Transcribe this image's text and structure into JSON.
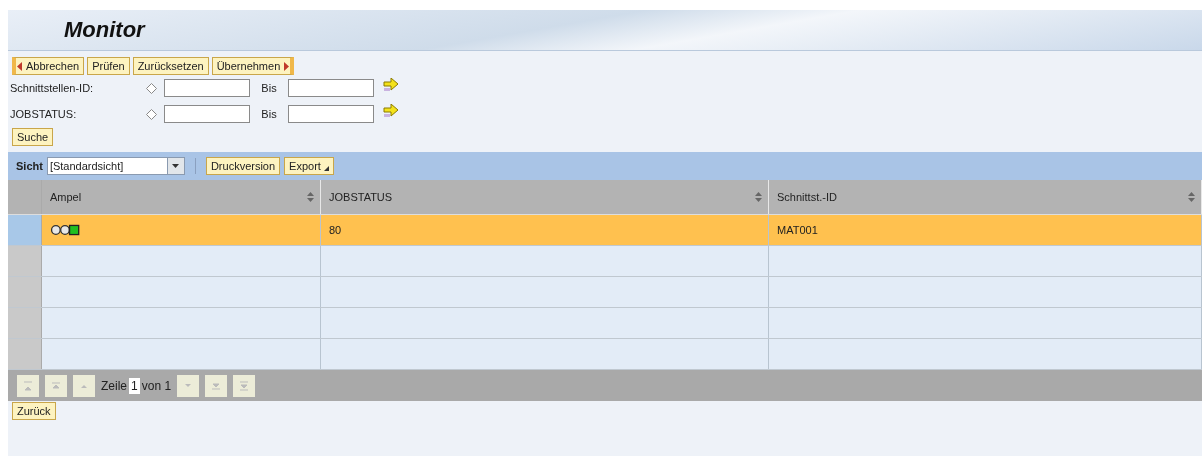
{
  "header": {
    "title": "Monitor"
  },
  "toolbar": {
    "buttons": [
      {
        "label": "Abbrechen",
        "kind": "first"
      },
      {
        "label": "Prüfen",
        "kind": "middle"
      },
      {
        "label": "Zurücksetzen",
        "kind": "middle"
      },
      {
        "label": "Übernehmen",
        "kind": "last"
      }
    ]
  },
  "filters": [
    {
      "label": "Schnittstellen-ID:",
      "to_label": "Bis"
    },
    {
      "label": "JOBSTATUS:",
      "to_label": "Bis"
    }
  ],
  "search_button": "Suche",
  "view_bar": {
    "label": "Sicht",
    "view": "[Standardsicht]",
    "buttons": [
      {
        "label": "Druckversion",
        "menu": false
      },
      {
        "label": "Export",
        "menu": true
      }
    ]
  },
  "table": {
    "columns": [
      "Ampel",
      "JOBSTATUS",
      "Schnittst.-ID"
    ],
    "rows": [
      {
        "selected": true,
        "status_ok": true,
        "jobstatus": "80",
        "interface_id": "MAT001"
      }
    ]
  },
  "pager": {
    "label": "Zeile",
    "page": "1",
    "of": "von 1"
  },
  "back_button": "Zurück"
}
